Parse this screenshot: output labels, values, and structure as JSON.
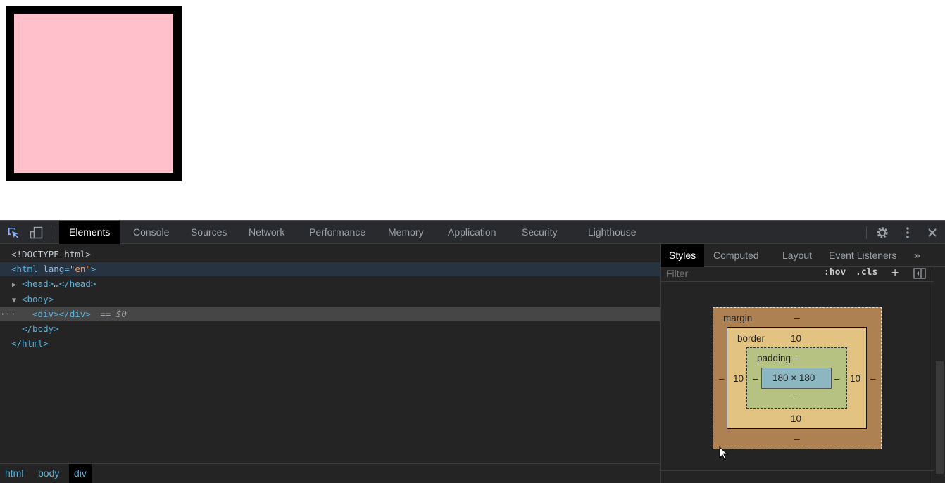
{
  "devtools": {
    "tabs": [
      "Elements",
      "Console",
      "Sources",
      "Network",
      "Performance",
      "Memory",
      "Application",
      "Security",
      "Lighthouse"
    ],
    "active_tab": "Elements"
  },
  "dom": {
    "doctype": "<!DOCTYPE html>",
    "html_open_tag": "<html",
    "html_attr_name": "lang",
    "html_attr_value": "\"en\"",
    "html_close_bracket": ">",
    "head_open": "<head>",
    "head_ellipsis": "…",
    "head_close": "</head>",
    "body_open": "<body>",
    "div_open": "<div>",
    "div_close": "</div>",
    "selected_marker": "== $0",
    "body_close": "</body>",
    "html_close": "</html>",
    "dots": "···"
  },
  "breadcrumbs": [
    "html",
    "body",
    "div"
  ],
  "side_panel": {
    "tabs": [
      "Styles",
      "Computed",
      "Layout",
      "Event Listeners"
    ],
    "active_tab": "Styles",
    "filter_placeholder": "Filter",
    "hov": ":hov",
    "cls": ".cls",
    "plus": "+"
  },
  "box_model": {
    "margin_label": "margin",
    "margin_top": "–",
    "margin_right": "–",
    "margin_bottom": "–",
    "margin_left": "–",
    "border_label": "border",
    "border_top": "10",
    "border_right": "10",
    "border_bottom": "10",
    "border_left": "10",
    "padding_label": "padding",
    "padding_top": "–",
    "padding_right": "–",
    "padding_bottom": "–",
    "padding_left": "–",
    "content": "180 × 180"
  },
  "colors": {
    "demo_box_fill": "#ffc0cb",
    "demo_box_border": "#000000",
    "margin": "#ae8152",
    "border": "#e3c381",
    "padding": "#b6c282",
    "content": "#8cb6c0",
    "accent": "#5db0d7"
  }
}
